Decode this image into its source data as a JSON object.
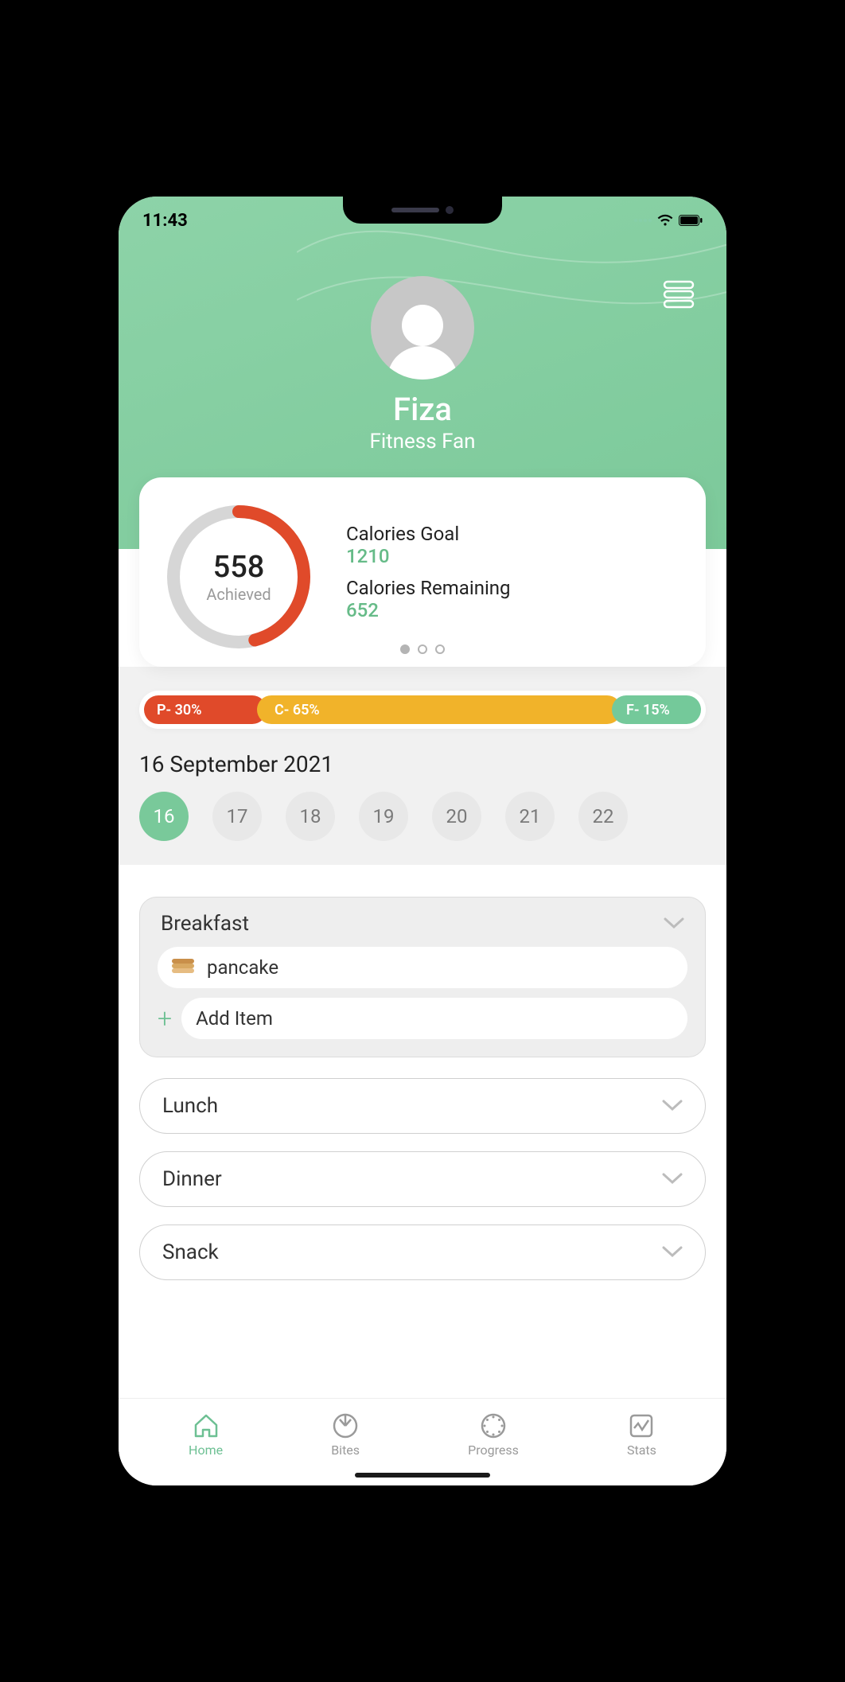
{
  "status": {
    "time": "11:43"
  },
  "profile": {
    "name": "Fiza",
    "subtitle": "Fitness Fan"
  },
  "calories": {
    "achieved_value": "558",
    "achieved_label": "Achieved",
    "goal_label": "Calories Goal",
    "goal_value": "1210",
    "remaining_label": "Calories Remaining",
    "remaining_value": "652"
  },
  "macros": {
    "protein": "P- 30%",
    "carbs": "C- 65%",
    "fat": "F- 15%"
  },
  "date_heading": "16 September 2021",
  "days": [
    "16",
    "17",
    "18",
    "19",
    "20",
    "21",
    "22"
  ],
  "meals": {
    "breakfast": {
      "title": "Breakfast",
      "item": "pancake",
      "add_label": "Add Item"
    },
    "lunch": "Lunch",
    "dinner": "Dinner",
    "snack": "Snack"
  },
  "nav": {
    "home": "Home",
    "bites": "Bites",
    "progress": "Progress",
    "stats": "Stats"
  }
}
